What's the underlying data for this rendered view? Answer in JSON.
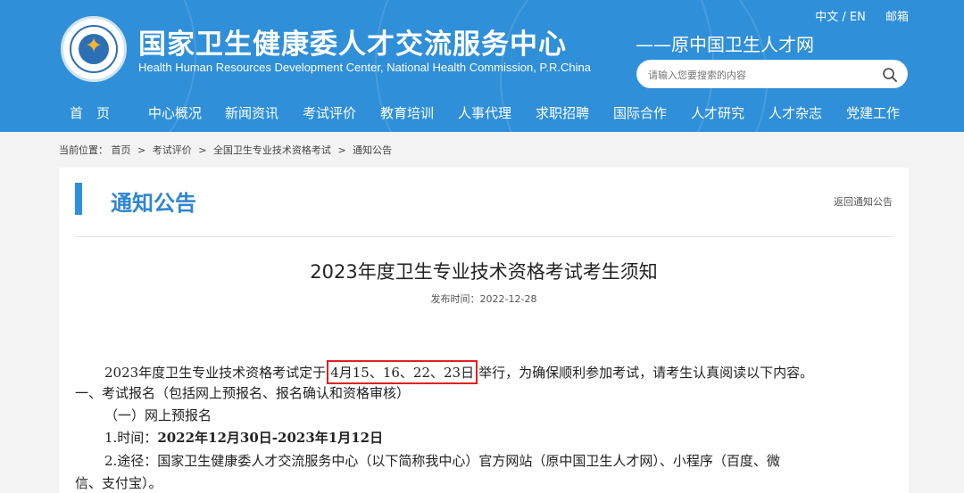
{
  "header": {
    "site_name_cn": "国家卫生健康委人才交流服务中心",
    "site_name_en": "Health Human Resources Development Center, National Health Commission, P.R.China",
    "site_subtitle": "——原中国卫生人才网",
    "lang_switch": "中文 / EN",
    "mail_link": "邮箱",
    "search_placeholder": "请输入您要搜索的内容",
    "brand_color": "#2f8fd8"
  },
  "nav": {
    "items": [
      "首　页",
      "中心概况",
      "新闻资讯",
      "考试评价",
      "教育培训",
      "人事代理",
      "求职招聘",
      "国际合作",
      "人才研究",
      "人才杂志",
      "党建工作"
    ]
  },
  "breadcrumb": {
    "label": "当前位置：",
    "items": [
      "首页",
      "考试评价",
      "全国卫生专业技术资格考试",
      "通知公告"
    ],
    "separator": ">"
  },
  "panel": {
    "section_title": "通知公告",
    "back_link": "返回通知公告"
  },
  "article": {
    "title": "2023年度卫生专业技术资格考试考生须知",
    "date_label": "发布时间：",
    "date": "2022-12-28",
    "p1_before": "2023年度卫生专业技术资格考试定于",
    "p1_highlight": "4月15、16、22、23日",
    "p1_after": "举行，为确保顺利参加考试，请考生认真阅读以下内容。",
    "heading1": "一、考试报名（包括网上预报名、报名确认和资格审核）",
    "sub1": "（一）网上预报名",
    "time_label": "1.时间：",
    "time_value": "2022年12月30日-2023年1月12日",
    "route_line1": "2.途径：国家卫生健康委人才交流服务中心（以下简称我中心）官方网站（原中国卫生人才网）、小程序（百度、微",
    "route_line2": "信、支付宝）。",
    "highlight_color": "#e02020"
  }
}
